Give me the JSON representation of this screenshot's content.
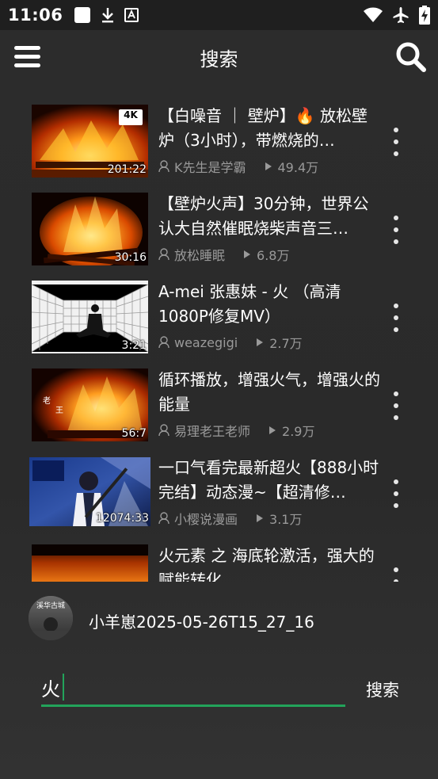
{
  "status_bar": {
    "time": "11:06",
    "left_icons": [
      "square-notification-icon",
      "download-icon",
      "text-notification-icon"
    ],
    "right_icons": [
      "wifi-icon",
      "airplane-icon",
      "battery-charging-icon"
    ]
  },
  "header": {
    "title": "搜索",
    "menu_icon": "hamburger-menu-icon",
    "search_icon": "search-icon"
  },
  "results": [
    {
      "title": "【白噪音 ｜ 壁炉】🔥 放松壁炉（3小时），带燃烧的…",
      "duration": "201:22",
      "author": "K先生是学霸",
      "views": "49.4万",
      "badge": "4K"
    },
    {
      "title": "【壁炉火声】30分钟，世界公认大自然催眠烧柴声音三…",
      "duration": "30:16",
      "author": "放松睡眠",
      "views": "6.8万"
    },
    {
      "title": "A-mei 张惠妹 - 火 （高清1080P修复MV）",
      "duration": "3:21",
      "author": "weazegigi",
      "views": "2.7万"
    },
    {
      "title": "循环播放，增强火气，增强火的能量",
      "duration": "56:7",
      "author": "易理老王老师",
      "views": "2.9万"
    },
    {
      "title": "一口气看完最新超火【888小时完结】动态漫~【超清修…",
      "duration": "12074:33",
      "author": "小樱说漫画",
      "views": "3.1万"
    },
    {
      "title": "火元素 之 海底轮激活，强大的赋能转化",
      "duration": "",
      "author": "",
      "views": ""
    }
  ],
  "account": {
    "name": "小羊崽2025-05-26T15_27_16",
    "avatar_text": "溪华古城"
  },
  "search": {
    "value": "火",
    "placeholder": "",
    "submit_label": "搜索"
  },
  "colors": {
    "accent": "#22a35a",
    "background": "#2b2b2b",
    "meta_text": "#9a9a9a"
  }
}
